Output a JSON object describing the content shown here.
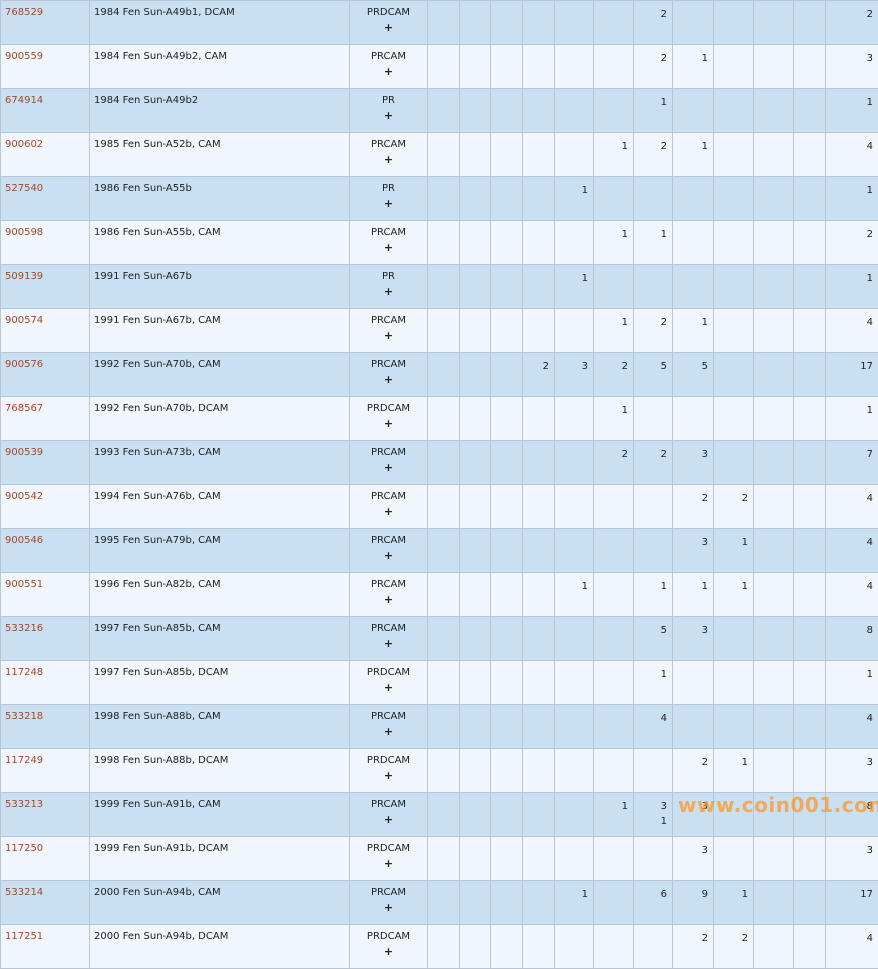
{
  "rows": [
    {
      "id": "768529",
      "name": "1984 Fen Sun-A49b1, DCAM",
      "des": "PRDCAM",
      "plus": "+",
      "g": [
        "",
        "",
        "",
        "",
        "",
        "",
        "2",
        "",
        "",
        "",
        ""
      ],
      "total": "2"
    },
    {
      "id": "900559",
      "name": "1984 Fen Sun-A49b2, CAM",
      "des": "PRCAM",
      "plus": "+",
      "g": [
        "",
        "",
        "",
        "",
        "",
        "",
        "2",
        "1",
        "",
        "",
        ""
      ],
      "total": "3"
    },
    {
      "id": "674914",
      "name": "1984 Fen Sun-A49b2",
      "des": "PR",
      "plus": "+",
      "g": [
        "",
        "",
        "",
        "",
        "",
        "",
        "1",
        "",
        "",
        "",
        ""
      ],
      "total": "1"
    },
    {
      "id": "900602",
      "name": "1985 Fen Sun-A52b, CAM",
      "des": "PRCAM",
      "plus": "+",
      "g": [
        "",
        "",
        "",
        "",
        "",
        "1",
        "2",
        "1",
        "",
        "",
        ""
      ],
      "total": "4"
    },
    {
      "id": "527540",
      "name": "1986 Fen Sun-A55b",
      "des": "PR",
      "plus": "+",
      "g": [
        "",
        "",
        "",
        "",
        "1",
        "",
        "",
        "",
        "",
        "",
        ""
      ],
      "total": "1"
    },
    {
      "id": "900598",
      "name": "1986 Fen Sun-A55b, CAM",
      "des": "PRCAM",
      "plus": "+",
      "g": [
        "",
        "",
        "",
        "",
        "",
        "1",
        "1",
        "",
        "",
        "",
        ""
      ],
      "total": "2"
    },
    {
      "id": "509139",
      "name": "1991 Fen Sun-A67b",
      "des": "PR",
      "plus": "+",
      "g": [
        "",
        "",
        "",
        "",
        "1",
        "",
        "",
        "",
        "",
        "",
        ""
      ],
      "total": "1"
    },
    {
      "id": "900574",
      "name": "1991 Fen Sun-A67b, CAM",
      "des": "PRCAM",
      "plus": "+",
      "g": [
        "",
        "",
        "",
        "",
        "",
        "1",
        "2",
        "1",
        "",
        "",
        ""
      ],
      "total": "4"
    },
    {
      "id": "900576",
      "name": "1992 Fen Sun-A70b, CAM",
      "des": "PRCAM",
      "plus": "+",
      "g": [
        "",
        "",
        "",
        "2",
        "3",
        "2",
        "5",
        "5",
        "",
        "",
        ""
      ],
      "total": "17"
    },
    {
      "id": "768567",
      "name": "1992 Fen Sun-A70b, DCAM",
      "des": "PRDCAM",
      "plus": "+",
      "g": [
        "",
        "",
        "",
        "",
        "",
        "1",
        "",
        "",
        "",
        "",
        ""
      ],
      "total": "1"
    },
    {
      "id": "900539",
      "name": "1993 Fen Sun-A73b, CAM",
      "des": "PRCAM",
      "plus": "+",
      "g": [
        "",
        "",
        "",
        "",
        "",
        "2",
        "2",
        "3",
        "",
        "",
        ""
      ],
      "total": "7"
    },
    {
      "id": "900542",
      "name": "1994 Fen Sun-A76b, CAM",
      "des": "PRCAM",
      "plus": "+",
      "g": [
        "",
        "",
        "",
        "",
        "",
        "",
        "",
        "2",
        "2",
        "",
        ""
      ],
      "total": "4"
    },
    {
      "id": "900546",
      "name": "1995 Fen Sun-A79b, CAM",
      "des": "PRCAM",
      "plus": "+",
      "g": [
        "",
        "",
        "",
        "",
        "",
        "",
        "",
        "3",
        "1",
        "",
        ""
      ],
      "total": "4"
    },
    {
      "id": "900551",
      "name": "1996 Fen Sun-A82b, CAM",
      "des": "PRCAM",
      "plus": "+",
      "g": [
        "",
        "",
        "",
        "",
        "1",
        "",
        "1",
        "1",
        "1",
        "",
        ""
      ],
      "total": "4"
    },
    {
      "id": "533216",
      "name": "1997 Fen Sun-A85b, CAM",
      "des": "PRCAM",
      "plus": "+",
      "g": [
        "",
        "",
        "",
        "",
        "",
        "",
        "5",
        "3",
        "",
        "",
        ""
      ],
      "total": "8"
    },
    {
      "id": "117248",
      "name": "1997 Fen Sun-A85b, DCAM",
      "des": "PRDCAM",
      "plus": "+",
      "g": [
        "",
        "",
        "",
        "",
        "",
        "",
        "1",
        "",
        "",
        "",
        ""
      ],
      "total": "1"
    },
    {
      "id": "533218",
      "name": "1998 Fen Sun-A88b, CAM",
      "des": "PRCAM",
      "plus": "+",
      "g": [
        "",
        "",
        "",
        "",
        "",
        "",
        "4",
        "",
        "",
        "",
        ""
      ],
      "total": "4"
    },
    {
      "id": "117249",
      "name": "1998 Fen Sun-A88b, DCAM",
      "des": "PRDCAM",
      "plus": "+",
      "g": [
        "",
        "",
        "",
        "",
        "",
        "",
        "",
        "2",
        "1",
        "",
        ""
      ],
      "total": "3"
    },
    {
      "id": "533213",
      "name": "1999 Fen Sun-A91b, CAM",
      "des": "PRCAM",
      "plus": "+",
      "g": [
        "",
        "",
        "",
        "",
        "",
        "1",
        "3",
        "3",
        "",
        "",
        ""
      ],
      "g2": [
        "",
        "",
        "",
        "",
        "",
        "",
        "1",
        "",
        "",
        "",
        ""
      ],
      "total": "8"
    },
    {
      "id": "117250",
      "name": "1999 Fen Sun-A91b, DCAM",
      "des": "PRDCAM",
      "plus": "+",
      "g": [
        "",
        "",
        "",
        "",
        "",
        "",
        "",
        "3",
        "",
        "",
        ""
      ],
      "total": "3"
    },
    {
      "id": "533214",
      "name": "2000 Fen Sun-A94b, CAM",
      "des": "PRCAM",
      "plus": "+",
      "g": [
        "",
        "",
        "",
        "",
        "1",
        "",
        "6",
        "9",
        "1",
        "",
        ""
      ],
      "total": "17"
    },
    {
      "id": "117251",
      "name": "2000 Fen Sun-A94b, DCAM",
      "des": "PRDCAM",
      "plus": "+",
      "g": [
        "",
        "",
        "",
        "",
        "",
        "",
        "",
        "2",
        "2",
        "",
        ""
      ],
      "total": "4"
    }
  ],
  "watermark": "www.coin001.com"
}
